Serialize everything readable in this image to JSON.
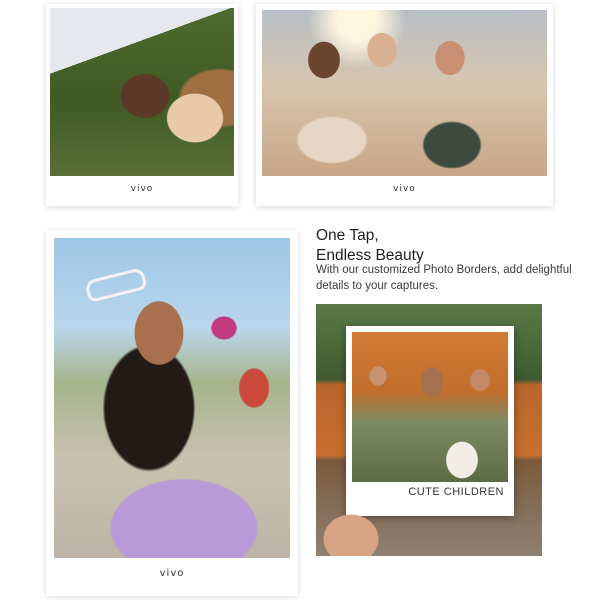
{
  "cards": [
    {
      "brand": "vivo"
    },
    {
      "brand": "vivo"
    },
    {
      "brand": "vivo"
    }
  ],
  "headline": {
    "line1": "One Tap,",
    "line2": "Endless Beauty"
  },
  "description": "With our customized Photo Borders, add delightful details to your captures.",
  "feature": {
    "caption": "CUTE CHILDREN"
  }
}
